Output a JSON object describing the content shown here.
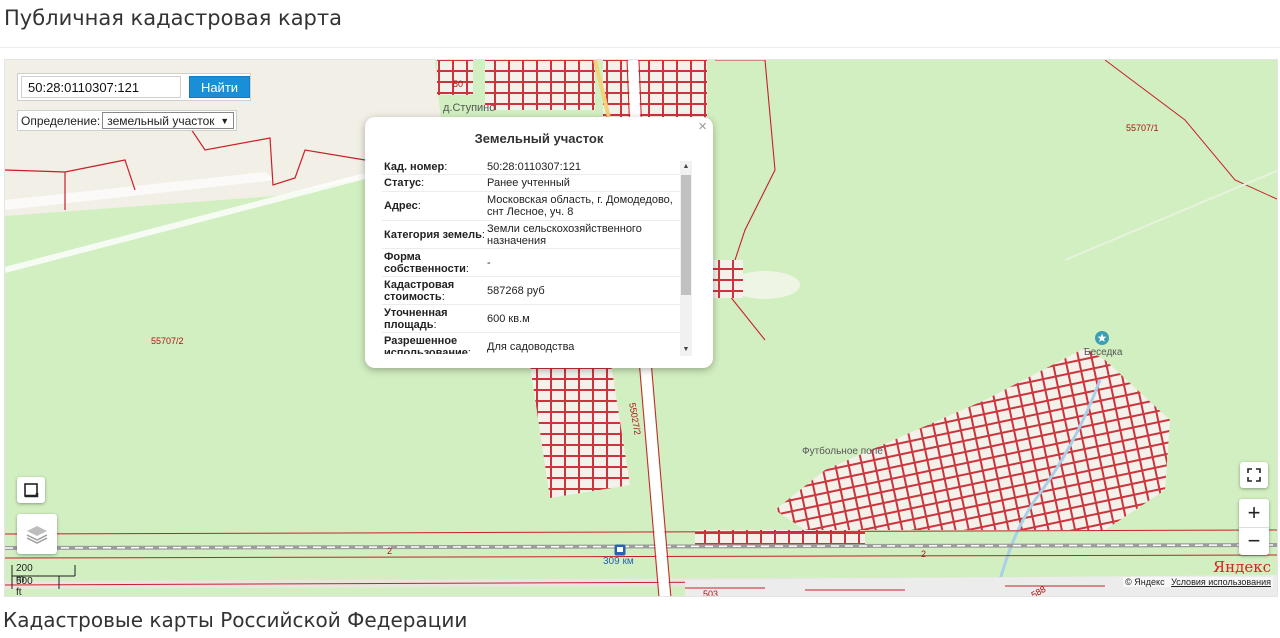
{
  "page": {
    "title": "Публичная кадастровая карта",
    "section_title": "Кадастровые карты Российской Федерации"
  },
  "search": {
    "value": "50:28:0110307:121",
    "button_label": "Найти",
    "definition_label": "Определение:",
    "definition_value": "земельный участок"
  },
  "popup": {
    "title": "Земельный участок",
    "close_symbol": "×",
    "rows": [
      {
        "key": "Кад. номер",
        "value": "50:28:0110307:121"
      },
      {
        "key": "Статус",
        "value": "Ранее учтенный"
      },
      {
        "key": "Адрес",
        "value": "Московская область, г. Домодедово, снт Лесное, уч. 8"
      },
      {
        "key": "Категория земель",
        "value": "Земли сельскохозяйственного назначения"
      },
      {
        "key": "Форма собственности",
        "value": "-"
      },
      {
        "key": "Кадастровая стоимость",
        "value": "587268 руб"
      },
      {
        "key": "Уточненная площадь",
        "value": "600 кв.м"
      },
      {
        "key": "Разрешенное использование",
        "value": "Для садоводства"
      }
    ]
  },
  "map": {
    "labels": {
      "parcel_55707_1": "55707/1",
      "parcel_55707_2": "55707/2",
      "parcel_55027_2": "55027/2",
      "parcel_50": "50",
      "road_2_left": "2",
      "road_2_right": "2",
      "bottom_503": "503",
      "bottom_588": "588"
    },
    "places": {
      "village": "д.Ступино",
      "gazebo": "Беседка",
      "football": "Футбольное поле",
      "station": "309 км"
    },
    "controls": {
      "zoom_in": "+",
      "zoom_out": "−"
    },
    "icons": [
      "ruler-icon",
      "layers-icon",
      "fullscreen-icon",
      "star-poi-icon",
      "rail-station-icon"
    ],
    "scale_m": "200 m",
    "scale_ft": "500 ft",
    "copyright": "© Яндекс",
    "terms": "Условия использования",
    "logo": "Яндекс"
  }
}
